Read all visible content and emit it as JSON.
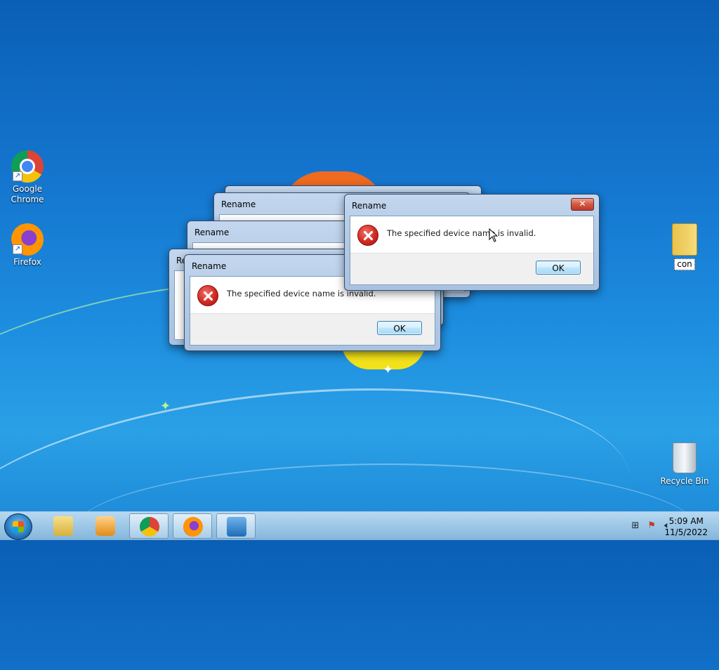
{
  "desktop": {
    "icons": [
      {
        "label_line1": "Google",
        "label_line2": "Chrome",
        "icon": "chrome-icon"
      },
      {
        "label_line1": "Firefox",
        "icon": "firefox-icon"
      },
      {
        "label": "con",
        "icon": "folder-icon"
      },
      {
        "label": "Recycle Bin",
        "icon": "recycle-bin-icon"
      }
    ]
  },
  "dialogs": {
    "title": "Rename",
    "message": "The specified device name is invalid.",
    "ok_label": "OK",
    "close_label": "✕",
    "icon": "error-icon"
  },
  "taskbar": {
    "items": [
      {
        "icon": "start-orb-icon"
      },
      {
        "icon": "explorer-icon"
      },
      {
        "icon": "media-player-icon"
      },
      {
        "icon": "chrome-icon"
      },
      {
        "icon": "firefox-icon"
      },
      {
        "icon": "remote-desktop-icon"
      }
    ],
    "tray_icons": [
      "network-icon",
      "action-center-icon",
      "volume-icon"
    ],
    "time": "5:09 AM",
    "date": "11/5/2022"
  },
  "colors": {
    "desktop_blue": "#1577d0",
    "error_red": "#d12a22",
    "close_red": "#c0392b"
  }
}
